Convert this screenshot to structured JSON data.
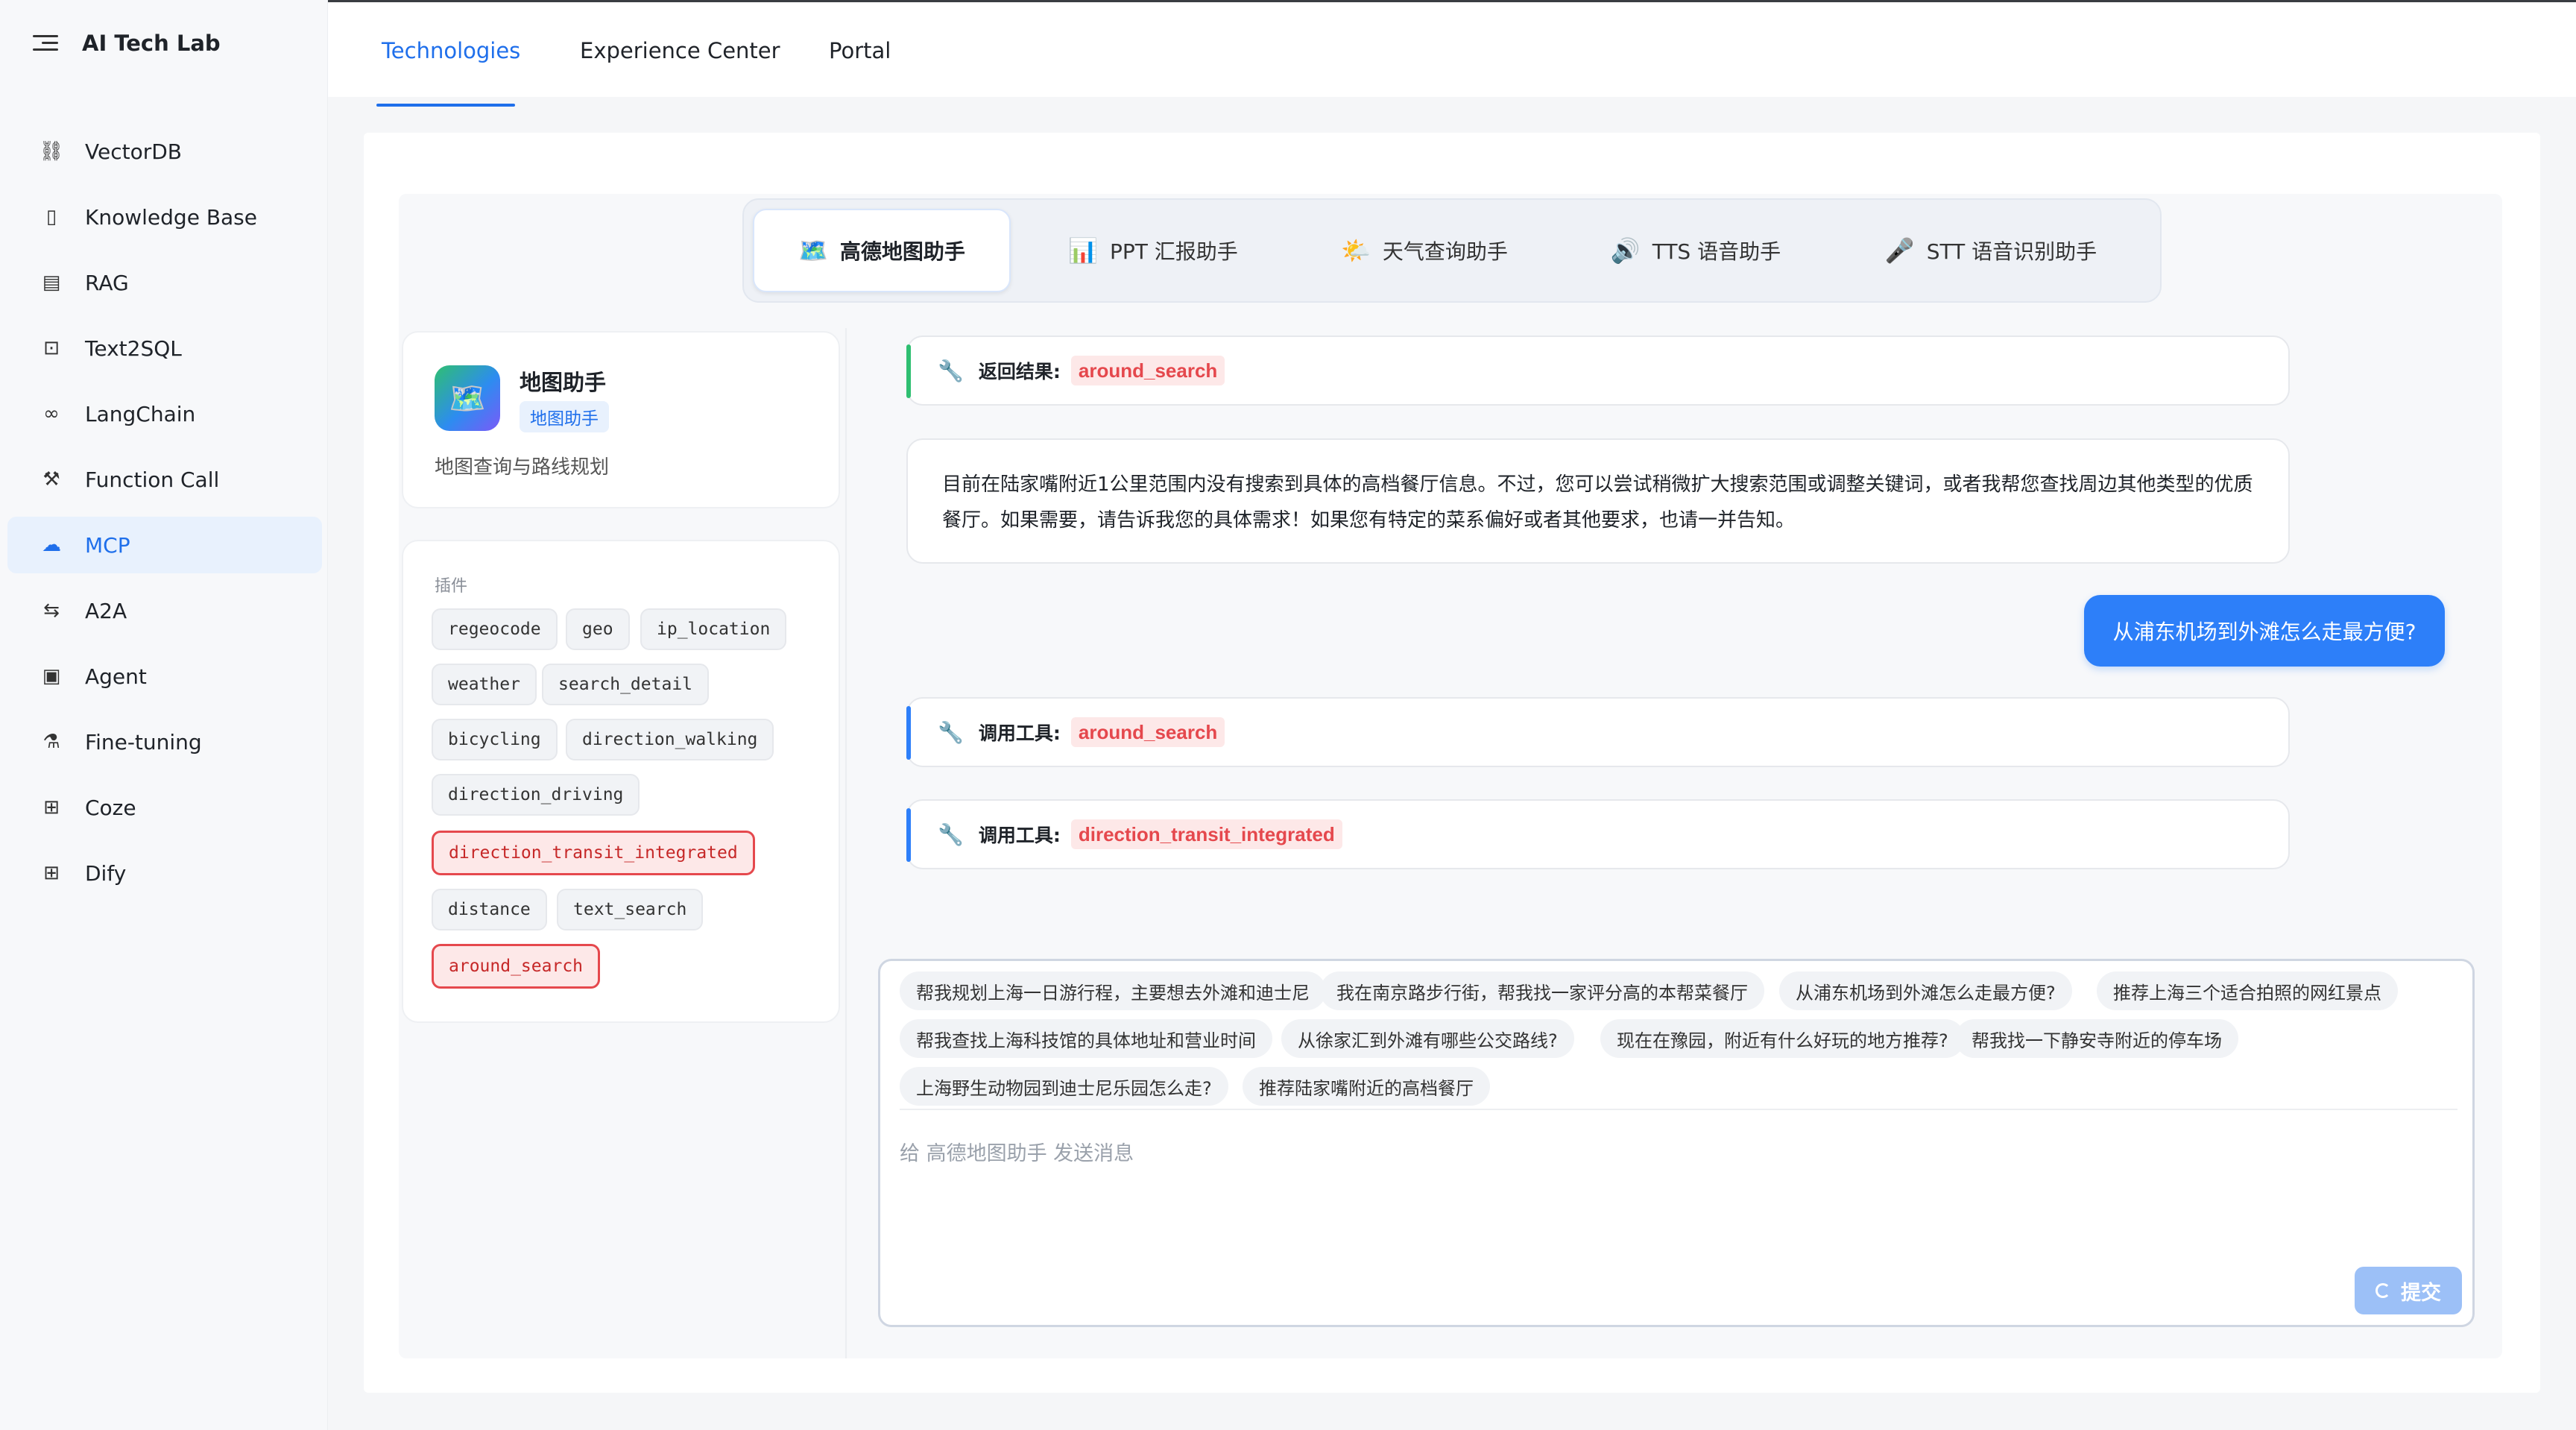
{
  "app": {
    "title": "AI Tech Lab"
  },
  "sidebar": {
    "items": [
      {
        "label": "VectorDB",
        "icon": "vector-icon",
        "glyph": "⛓"
      },
      {
        "label": "Knowledge Base",
        "icon": "book-icon",
        "glyph": "▯"
      },
      {
        "label": "RAG",
        "icon": "doc-icon",
        "glyph": "▤"
      },
      {
        "label": "Text2SQL",
        "icon": "terminal-icon",
        "glyph": "⊡"
      },
      {
        "label": "LangChain",
        "icon": "link-icon",
        "glyph": "∞"
      },
      {
        "label": "Function Call",
        "icon": "tool-icon",
        "glyph": "⚒"
      },
      {
        "label": "MCP",
        "icon": "cloud-icon",
        "glyph": "☁"
      },
      {
        "label": "A2A",
        "icon": "swap-icon",
        "glyph": "⇆"
      },
      {
        "label": "Agent",
        "icon": "agent-icon",
        "glyph": "▣"
      },
      {
        "label": "Fine-tuning",
        "icon": "flask-icon",
        "glyph": "⚗"
      },
      {
        "label": "Coze",
        "icon": "grid-icon",
        "glyph": "⊞"
      },
      {
        "label": "Dify",
        "icon": "grid-icon",
        "glyph": "⊞"
      }
    ],
    "active_index": 6
  },
  "topnav": {
    "tabs": [
      "Technologies",
      "Experience Center",
      "Portal"
    ],
    "active": "Technologies"
  },
  "agent_tabs": [
    {
      "emoji": "🗺️",
      "label": "高德地图助手"
    },
    {
      "emoji": "📊",
      "label": "PPT 汇报助手"
    },
    {
      "emoji": "🌤️",
      "label": "天气查询助手"
    },
    {
      "emoji": "🔊",
      "label": "TTS 语音助手"
    },
    {
      "emoji": "🎤",
      "label": "STT 语音识别助手"
    }
  ],
  "assistant": {
    "avatar_emoji": "🗺️",
    "name": "地图助手",
    "badge": "地图助手",
    "description": "地图查询与路线规划"
  },
  "plugins": {
    "label": "插件",
    "items": [
      {
        "name": "regeocode",
        "highlighted": false
      },
      {
        "name": "geo",
        "highlighted": false
      },
      {
        "name": "ip_location",
        "highlighted": false
      },
      {
        "name": "weather",
        "highlighted": false
      },
      {
        "name": "search_detail",
        "highlighted": false
      },
      {
        "name": "bicycling",
        "highlighted": false
      },
      {
        "name": "direction_walking",
        "highlighted": false
      },
      {
        "name": "direction_driving",
        "highlighted": false
      },
      {
        "name": "direction_transit_integrated",
        "highlighted": true
      },
      {
        "name": "distance",
        "highlighted": false
      },
      {
        "name": "text_search",
        "highlighted": false
      },
      {
        "name": "around_search",
        "highlighted": true
      }
    ]
  },
  "chat": {
    "result_msg": {
      "label": "返回结果:",
      "tool": "around_search"
    },
    "ai_msg": "目前在陆家嘴附近1公里范围内没有搜索到具体的高档餐厅信息。不过，您可以尝试稍微扩大搜索范围或调整关键词，或者我帮您查找周边其他类型的优质餐厅。如果需要，请告诉我您的具体需求！如果您有特定的菜系偏好或者其他要求，也请一并告知。",
    "user_msg": "从浦东机场到外滩怎么走最方便?",
    "tool_call_1": {
      "label": "调用工具:",
      "tool": "around_search"
    },
    "tool_call_2": {
      "label": "调用工具:",
      "tool": "direction_transit_integrated"
    }
  },
  "composer": {
    "suggestions": [
      "帮我规划上海一日游行程，主要想去外滩和迪士尼",
      "我在南京路步行街，帮我找一家评分高的本帮菜餐厅",
      "从浦东机场到外滩怎么走最方便?",
      "推荐上海三个适合拍照的网红景点",
      "帮我查找上海科技馆的具体地址和营业时间",
      "从徐家汇到外滩有哪些公交路线?",
      "现在在豫园，附近有什么好玩的地方推荐?",
      "帮我找一下静安寺附近的停车场",
      "上海野生动物园到迪士尼乐园怎么走?",
      "推荐陆家嘴附近的高档餐厅"
    ],
    "placeholder": "给 高德地图助手 发送消息",
    "submit_label": "提交"
  },
  "colors": {
    "accent": "#1f6feb",
    "user_bubble": "#2d7ff9",
    "tool_tag_bg": "#fde8e8",
    "tool_tag_text": "#e5484d",
    "result_bar": "#2fbf71",
    "call_bar": "#2d7ff9"
  }
}
